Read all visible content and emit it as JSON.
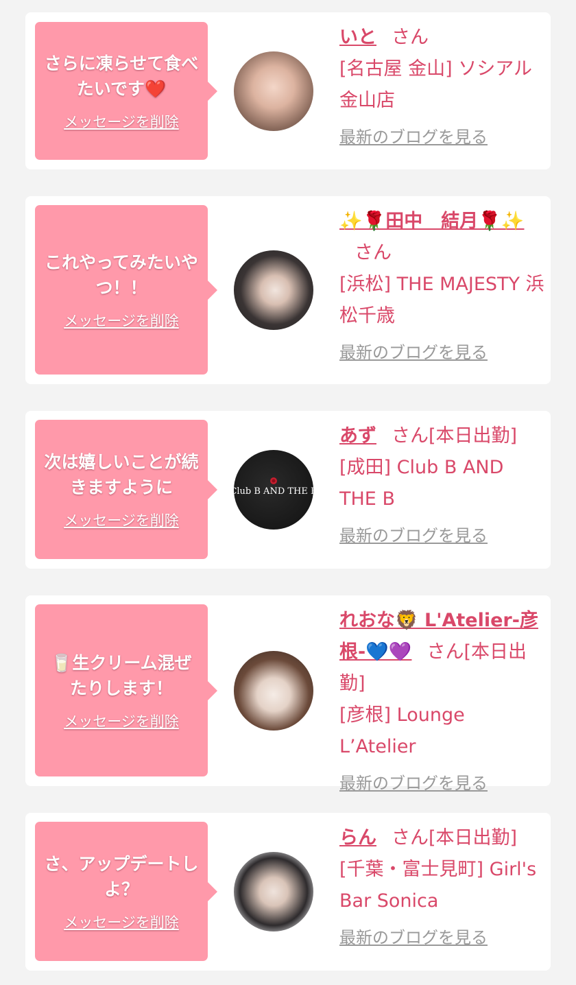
{
  "items": [
    {
      "message": "さらに凍らせて食べたいです❤️",
      "delete_label": "メッセージを削除",
      "name": "いと",
      "honorific": "さん",
      "shop": "[名古屋 金山] ソシアル金山店",
      "blog_label": "最新のブログを見る"
    },
    {
      "message": "これやってみたいやつ！！",
      "delete_label": "メッセージを削除",
      "name": "✨🌹田中　結月🌹✨",
      "honorific": "さん",
      "shop": "[浜松] THE MAJESTY 浜松千歳",
      "blog_label": "最新のブログを見る"
    },
    {
      "message": "次は嬉しいことが続きますように",
      "delete_label": "メッセージを削除",
      "name": "あず",
      "honorific": "さん[本日出勤]",
      "shop": "[成田] Club B AND THE B",
      "blog_label": "最新のブログを見る",
      "avatar_text": "Club B AND THE B"
    },
    {
      "message": "🥛生クリーム混ぜたりします！",
      "delete_label": "メッセージを削除",
      "name": "れおな🦁 L'Atelier-彦根-💙💜",
      "honorific": "さん[本日出勤]",
      "shop": "[彦根] Lounge L’Atelier",
      "blog_label": "最新のブログを見る"
    },
    {
      "message": "さ、アップデートしよ？",
      "delete_label": "メッセージを削除",
      "name": "らん",
      "honorific": "さん[本日出勤]",
      "shop": "[千葉・富士見町] Girl's Bar Sonica",
      "blog_label": "最新のブログを見る"
    }
  ],
  "colors": {
    "background": "#f3f3f3",
    "card": "#ffffff",
    "bubble": "#ff99aa",
    "accent": "#d94869",
    "muted": "#999999"
  }
}
